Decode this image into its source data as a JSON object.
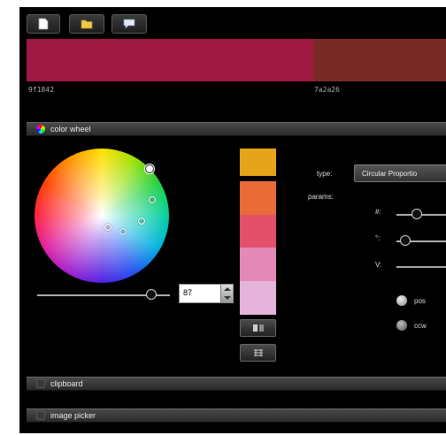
{
  "toolbar": {
    "buttons": [
      {
        "name": "new-document-button",
        "icon": "document-icon"
      },
      {
        "name": "open-folder-button",
        "icon": "folder-icon"
      },
      {
        "name": "comment-button",
        "icon": "speech-bubble-icon"
      }
    ]
  },
  "swatches": [
    {
      "hex": "9f1842",
      "color": "#9f1842"
    },
    {
      "hex": "7a2a26",
      "color": "#7a2a26"
    }
  ],
  "sections": {
    "color_wheel": "color wheel",
    "clipboard": "clipboard",
    "image_picker": "image picker"
  },
  "wheel": {
    "brightness_value": "87"
  },
  "palette": [
    "#e6a41a",
    "#e96b38",
    "#e4506c",
    "#e488b6",
    "#e5b4da"
  ],
  "params": {
    "type_label": "type:",
    "type_value": "Circular Proportio",
    "params_label": "params:",
    "num_label": "#:",
    "angle_label": "°:",
    "v_label": "V:",
    "radio_pos": "pos",
    "radio_ccw": "ccw"
  },
  "colors": {
    "background": "#000000",
    "bar": "#3a3a3a"
  }
}
